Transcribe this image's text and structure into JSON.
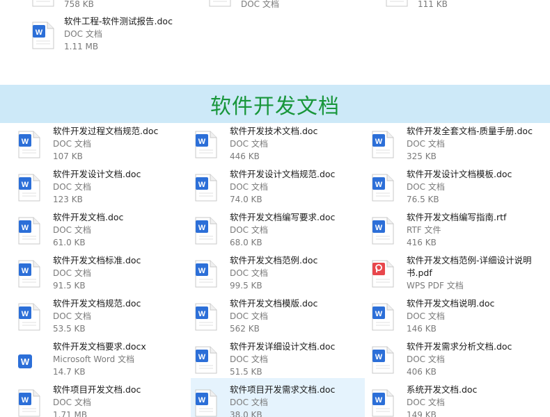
{
  "top_partial": {
    "items": [
      {
        "size": "758 KB"
      },
      {
        "type": "DOC 文档"
      },
      {
        "size": "111 KB"
      }
    ],
    "file": {
      "name": "软件工程-软件测试报告.doc",
      "type": "DOC 文档",
      "size": "1.11 MB",
      "icon": "wps-doc-icon"
    }
  },
  "section": {
    "title": "软件开发文档"
  },
  "files": [
    {
      "name": "软件开发过程文档规范.doc",
      "type": "DOC 文档",
      "size": "107 KB",
      "icon": "wps-doc-icon"
    },
    {
      "name": "软件开发技术文档.doc",
      "type": "DOC 文档",
      "size": "446 KB",
      "icon": "wps-doc-icon"
    },
    {
      "name": "软件开发全套文档-质量手册.doc",
      "type": "DOC 文档",
      "size": "325 KB",
      "icon": "wps-doc-icon"
    },
    {
      "name": "软件开发设计文档.doc",
      "type": "DOC 文档",
      "size": "123 KB",
      "icon": "wps-doc-icon"
    },
    {
      "name": "软件开发设计文档规范.doc",
      "type": "DOC 文档",
      "size": "74.0 KB",
      "icon": "wps-doc-icon"
    },
    {
      "name": "软件开发设计文档模板.doc",
      "type": "DOC 文档",
      "size": "76.5 KB",
      "icon": "wps-doc-icon"
    },
    {
      "name": "软件开发文档.doc",
      "type": "DOC 文档",
      "size": "61.0 KB",
      "icon": "wps-doc-icon"
    },
    {
      "name": "软件开发文档编写要求.doc",
      "type": "DOC 文档",
      "size": "68.0 KB",
      "icon": "wps-doc-icon"
    },
    {
      "name": "软件开发文档编写指南.rtf",
      "type": "RTF 文件",
      "size": "416 KB",
      "icon": "wps-doc-icon"
    },
    {
      "name": "软件开发文档标准.doc",
      "type": "DOC 文档",
      "size": "91.5 KB",
      "icon": "wps-doc-icon"
    },
    {
      "name": "软件开发文档范例.doc",
      "type": "DOC 文档",
      "size": "99.5 KB",
      "icon": "wps-doc-icon"
    },
    {
      "name": "软件开发文档范例-详细设计说明书.pdf",
      "type": "WPS PDF 文档",
      "size": "",
      "icon": "wps-pdf-icon"
    },
    {
      "name": "软件开发文档规范.doc",
      "type": "DOC 文档",
      "size": "53.5 KB",
      "icon": "wps-doc-icon"
    },
    {
      "name": "软件开发文档模版.doc",
      "type": "DOC 文档",
      "size": "562 KB",
      "icon": "wps-doc-icon"
    },
    {
      "name": "软件开发文档说明.doc",
      "type": "DOC 文档",
      "size": "146 KB",
      "icon": "wps-doc-icon"
    },
    {
      "name": "软件开发文档要求.docx",
      "type": "Microsoft Word 文档",
      "size": "14.7 KB",
      "icon": "word-docx-icon"
    },
    {
      "name": "软件开发详细设计文档.doc",
      "type": "DOC 文档",
      "size": "51.5 KB",
      "icon": "wps-doc-icon"
    },
    {
      "name": "软件开发需求分析文档.doc",
      "type": "DOC 文档",
      "size": "406 KB",
      "icon": "wps-doc-icon"
    },
    {
      "name": "软件项目开发文档.doc",
      "type": "DOC 文档",
      "size": "1.71 MB",
      "icon": "wps-doc-icon"
    },
    {
      "name": "软件项目开发需求文档.doc",
      "type": "DOC 文档",
      "size": "38.0 KB",
      "icon": "wps-doc-icon",
      "selected": true
    },
    {
      "name": "系统开发文档.doc",
      "type": "DOC 文档",
      "size": "149 KB",
      "icon": "wps-doc-icon"
    }
  ],
  "colors": {
    "banner_bg": "#cde9f8",
    "banner_text": "#18963a",
    "selection_bg": "#e5f3fd",
    "doc_blue": "#2c6fd8",
    "pdf_red": "#e8474c"
  }
}
